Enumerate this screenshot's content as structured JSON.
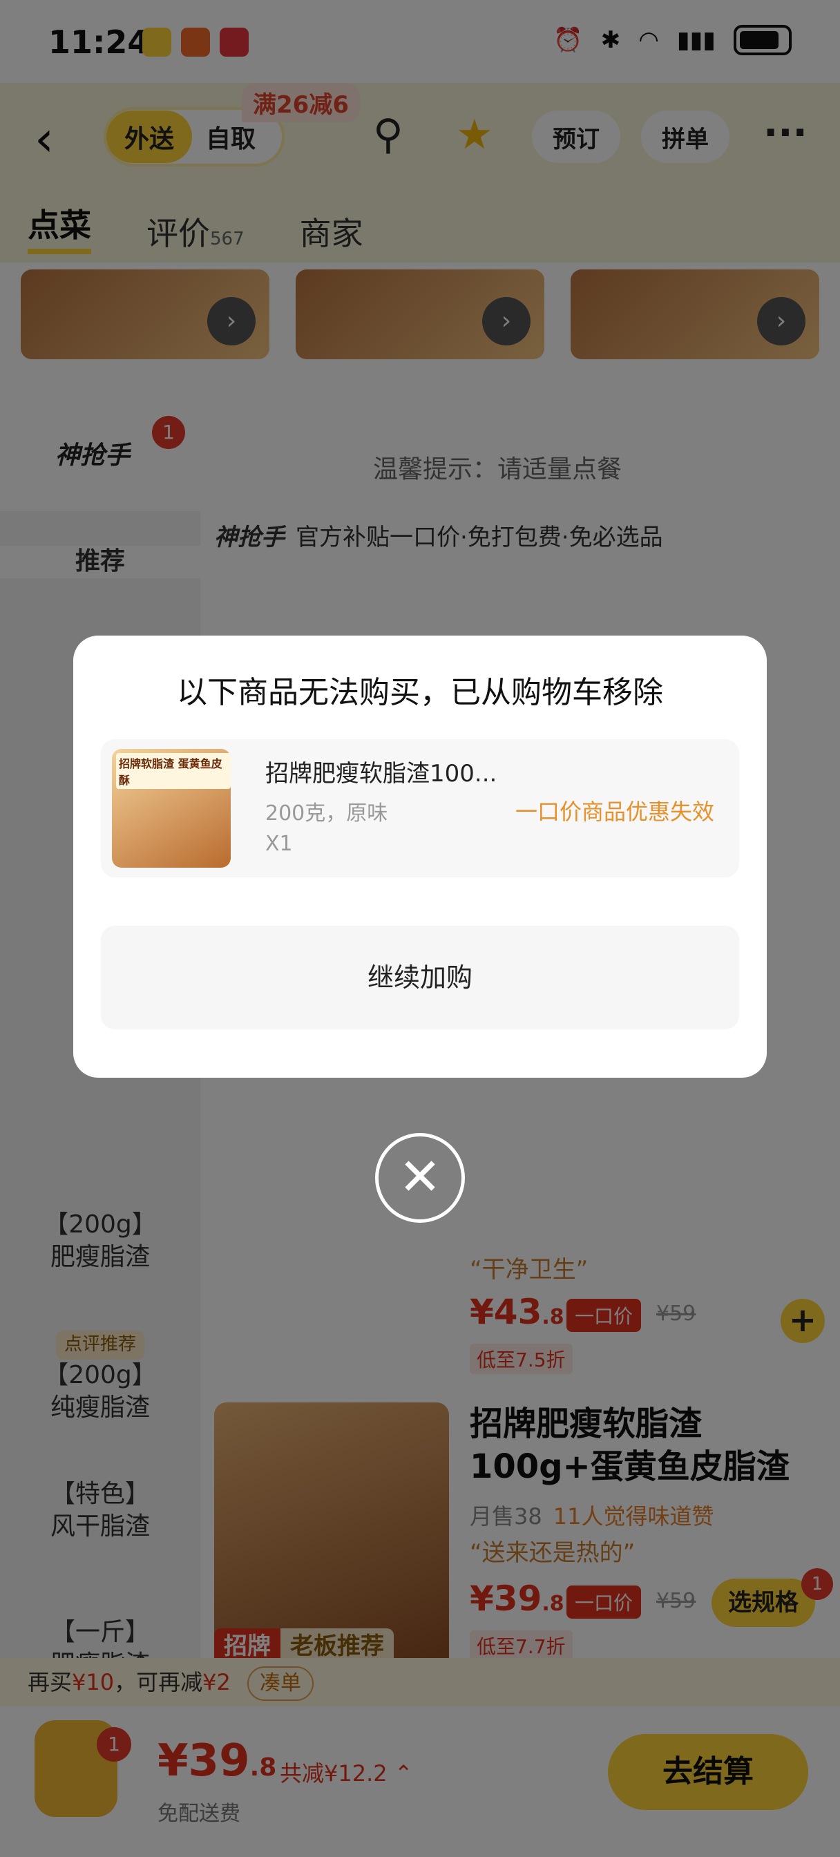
{
  "status_bar": {
    "time": "11:24"
  },
  "header": {
    "mode_active": "外送",
    "mode_inactive": "自取",
    "promo_tag": "满26减6",
    "btn_reserve": "预订",
    "btn_group": "拼单",
    "tabs": [
      {
        "label": "点菜",
        "sub": ""
      },
      {
        "label": "评价",
        "sub": "567"
      },
      {
        "label": "商家",
        "sub": ""
      }
    ]
  },
  "shop": {
    "logo": "神抢手",
    "badge": "1",
    "tip": "温馨提示：请适量点餐"
  },
  "sidebar": {
    "items": [
      {
        "label": "推荐"
      },
      {
        "label": "【200g】\n肥瘦脂渣"
      },
      {
        "tag": "点评推荐",
        "label": "【200g】\n纯瘦脂渣"
      },
      {
        "label": "【特色】\n风干脂渣"
      },
      {
        "label": "【一斤】\n肥瘦脂渣"
      }
    ]
  },
  "content": {
    "banner_logo": "神抢手",
    "banner_text": "官方补贴一口价·免打包费·免必选品",
    "products": [
      {
        "quote": "“干净卫生”",
        "price": "¥43",
        "price_dec": ".8",
        "one_price": "一口价",
        "orig": "¥59",
        "low": "低至7.5折",
        "btn": "+"
      },
      {
        "title": "招牌肥瘦软脂渣100g+蛋黄鱼皮脂渣",
        "sold": "月售38",
        "good": "11人觉得味道赞",
        "quote": "“送来还是热的”",
        "price": "¥39",
        "price_dec": ".8",
        "one_price": "一口价",
        "orig": "¥59",
        "low": "低至7.7折",
        "btn": "选规格",
        "badge": "1"
      }
    ],
    "section_tag_a": "招牌",
    "section_tag_b": "老板推荐"
  },
  "promo_bar": {
    "text1": "再买",
    "amount1": "¥10",
    "text2": "，可再减",
    "amount2": "¥2",
    "chip": "凑单"
  },
  "bottom": {
    "cart_badge": "1",
    "total": "¥39",
    "total_dec": ".8",
    "saved": "共减¥12.2",
    "free_ship": "免配送费",
    "checkout": "去结算"
  },
  "dialog": {
    "title": "以下商品无法购买，已从购物车移除",
    "item": {
      "thumb_text": "招牌软脂渣 蛋黄鱼皮酥",
      "name": "招牌肥瘦软脂渣100...",
      "spec": "200克，原味",
      "qty": "X1",
      "reason": "一口价商品优惠失效"
    },
    "continue": "继续加购"
  },
  "colors": {
    "brand_yellow": "#ffd23a",
    "price_red": "#e5321e",
    "warn_orange": "#e6912b"
  }
}
